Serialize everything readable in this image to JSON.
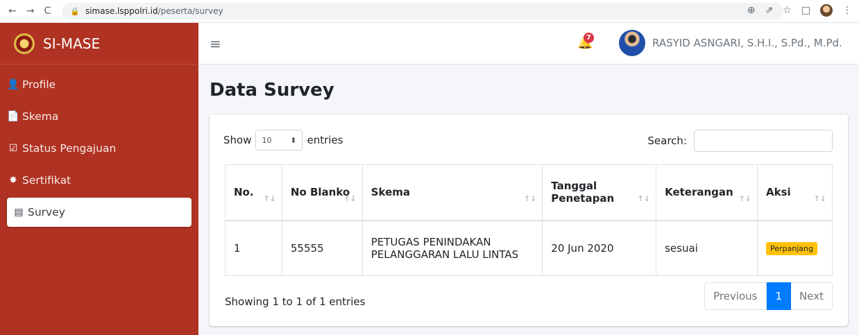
{
  "browser": {
    "nav": {
      "back": "←",
      "forward": "→",
      "reload": "C"
    },
    "url_host": "simase.lsppolri.id",
    "url_path": "/peserta/survey",
    "icons": [
      "zoom-icon",
      "share-icon",
      "star-icon",
      "sidepanel-icon",
      "profile-icon",
      "menu-icon"
    ],
    "icon_glyphs": {
      "zoom": "⊕",
      "share": "⇗",
      "star": "☆",
      "sidepanel": "□",
      "menu": "⋮"
    }
  },
  "brand": {
    "name": "SI-MASE"
  },
  "sidebar": {
    "items": [
      {
        "label": "Profile",
        "icon": "user-icon",
        "glyph": "👤",
        "active": false
      },
      {
        "label": "Skema",
        "icon": "file-icon",
        "glyph": "📄",
        "active": false
      },
      {
        "label": "Status Pengajuan",
        "icon": "check-square-icon",
        "glyph": "☑",
        "active": false
      },
      {
        "label": "Sertifikat",
        "icon": "certificate-icon",
        "glyph": "✸",
        "active": false
      },
      {
        "label": "Survey",
        "icon": "survey-icon",
        "glyph": "▤",
        "active": true
      }
    ]
  },
  "topbar": {
    "hamburger": "≡",
    "bell_glyph": "🔔",
    "notification_count": "7",
    "user_name": "RASYID ASNGARI, S.H.I., S.Pd., M.Pd."
  },
  "page": {
    "title": "Data Survey"
  },
  "table_controls": {
    "show_label": "Show",
    "entries_label": "entries",
    "page_length": "10",
    "select_arrow": "⬍",
    "search_label": "Search:",
    "search_value": ""
  },
  "table": {
    "headers": [
      {
        "label": "No.",
        "sort": "↑↓"
      },
      {
        "label": "No Blanko",
        "sort": "↑↓"
      },
      {
        "label": "Skema",
        "sort": "↑↓"
      },
      {
        "label": "Tanggal Penetapan",
        "sort": "↑↓"
      },
      {
        "label": "Keterangan",
        "sort": "↑↓"
      },
      {
        "label": "Aksi",
        "sort": "↑↓"
      }
    ],
    "rows": [
      {
        "no": "1",
        "no_blanko": "55555",
        "skema": "PETUGAS PENINDAKAN PELANGGARAN LALU LINTAS",
        "tanggal": "20 Jun 2020",
        "keterangan": "sesuai",
        "aksi": "Perpanjang"
      }
    ]
  },
  "footer": {
    "info": "Showing 1 to 1 of 1 entries",
    "previous": "Previous",
    "current_page": "1",
    "next": "Next"
  },
  "colors": {
    "sidebar": "#b03222",
    "primary": "#007bff",
    "warning": "#ffc107",
    "badge": "#dc3545"
  }
}
